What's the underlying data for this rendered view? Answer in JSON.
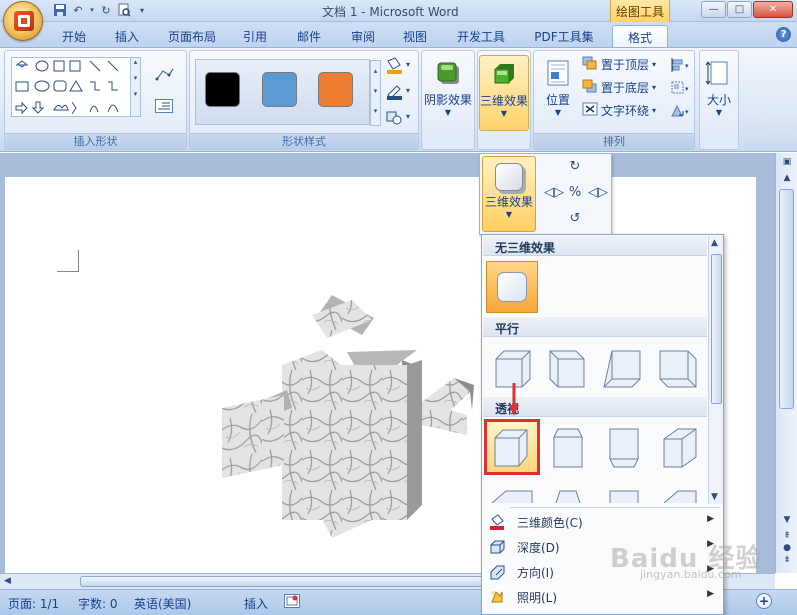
{
  "window": {
    "title": "文档 1 - Microsoft Word",
    "context_tab_title": "绘图工具",
    "controls": [
      "—",
      "□",
      "✕"
    ]
  },
  "tabs": [
    "开始",
    "插入",
    "页面布局",
    "引用",
    "邮件",
    "审阅",
    "视图",
    "开发工具",
    "PDF工具集",
    "格式"
  ],
  "active_tab": "格式",
  "ribbon": {
    "groups": {
      "insert_shapes": "插入形状",
      "shape_styles": "形状样式",
      "arrange": "排列"
    },
    "swatch_colors": [
      "#000000",
      "#5b9bd5",
      "#ed7d31"
    ],
    "buttons": {
      "shadow_effects": "阴影效果",
      "three_d_effects": "三维效果",
      "position": "位置",
      "bring_to_front": "置于顶层",
      "send_to_back": "置于底层",
      "text_wrapping": "文字环绕",
      "size": "大小"
    }
  },
  "arrange_panel": {
    "three_d_button": "三维效果"
  },
  "menu": {
    "sections": {
      "none": "无三维效果",
      "parallel": "平行",
      "perspective": "透视"
    },
    "items": [
      {
        "label": "三维颜色(C)",
        "icon": "paint-bucket-icon"
      },
      {
        "label": "深度(D)",
        "icon": "depth-icon"
      },
      {
        "label": "方向(I)",
        "icon": "direction-icon"
      },
      {
        "label": "照明(L)",
        "icon": "lighting-icon"
      }
    ]
  },
  "status": {
    "page": "页面: 1/1",
    "words": "字数: 0",
    "language": "英语(美国)",
    "mode": "插入"
  },
  "watermark": {
    "brand": "Baidu 经验",
    "url": "jingyan.baidu.com"
  }
}
